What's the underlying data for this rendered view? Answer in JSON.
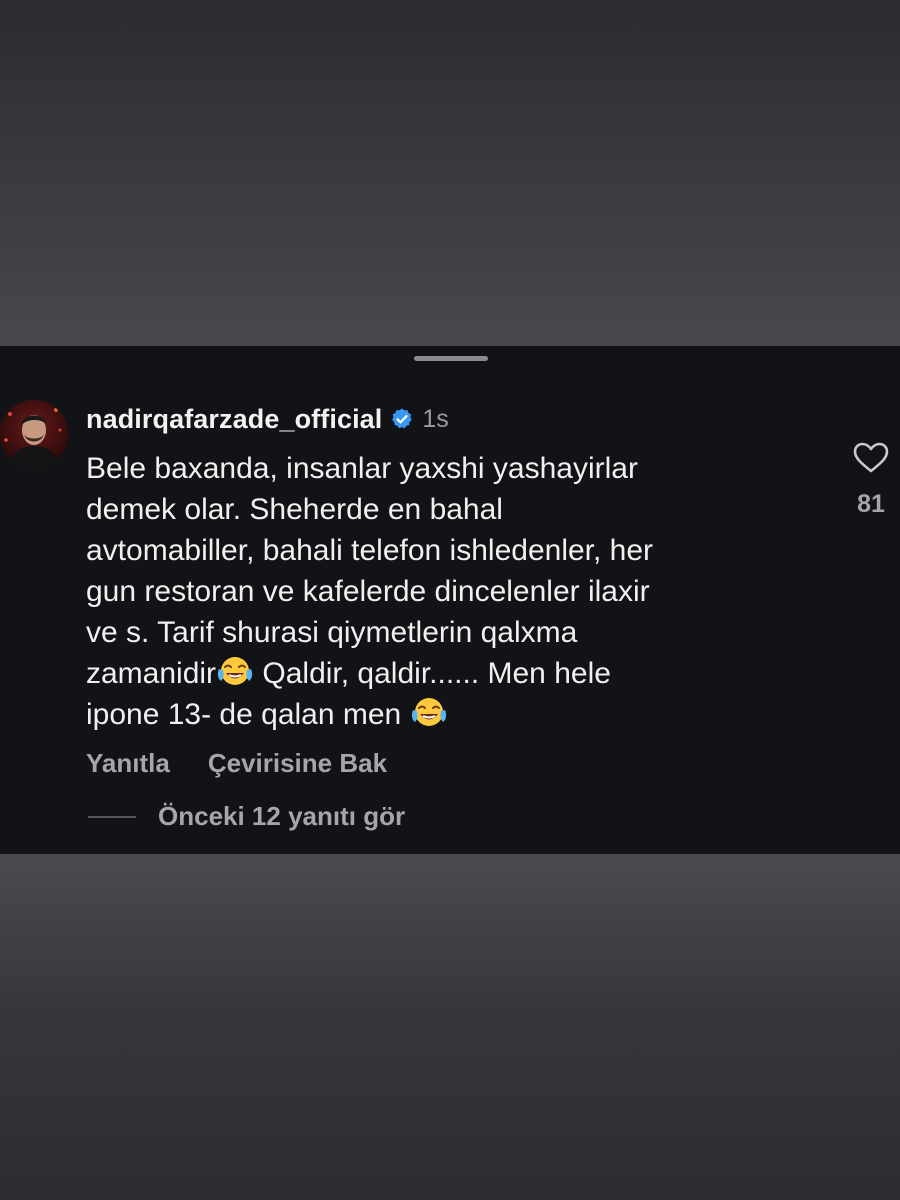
{
  "comment": {
    "username": "nadirqafarzade_official",
    "timestamp": "1s",
    "text_part1": "Bele baxanda, insanlar yaxshi yashayirlar\ndemek olar. Sheherde en bahal\navtomabiller, bahali telefon ishledenler, her\ngun restoran ve kafelerde dincelenler ilaxir\nve s. Tarif shurasi qiymetlerin qalxma\nzamanidir",
    "text_part2": " Qaldir, qaldir...... Men hele\nipone 13- de qalan men ",
    "emoji_name": "face-with-tears-of-joy-icon",
    "like_count": "81"
  },
  "actions": {
    "reply_label": "Yanıtla",
    "translate_label": "Çevirisine Bak"
  },
  "replies": {
    "label": "Önceki 12 yanıtı gör"
  },
  "colors": {
    "sheet_background": "#121316",
    "primary_text": "#f0f0f0",
    "secondary_text": "#a4a6aa",
    "verified_badge": "#3897f0"
  }
}
